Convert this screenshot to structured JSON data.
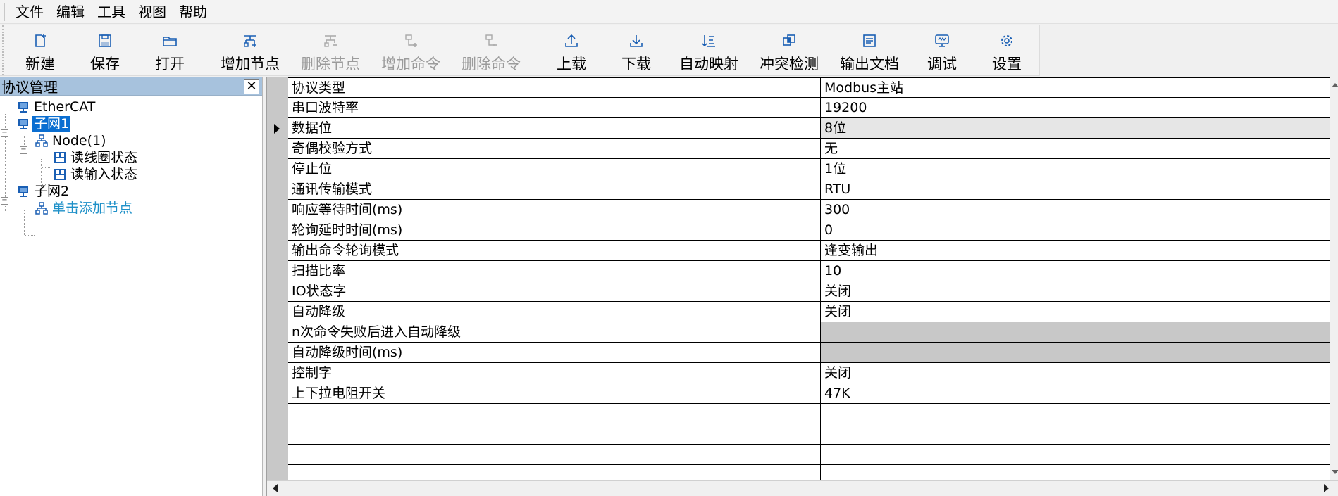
{
  "menu": [
    "文件",
    "编辑",
    "工具",
    "视图",
    "帮助"
  ],
  "toolbar": {
    "group1": [
      {
        "label": "新建",
        "icon": "new-file-icon",
        "enabled": true
      },
      {
        "label": "保存",
        "icon": "save-icon",
        "enabled": true
      },
      {
        "label": "打开",
        "icon": "open-folder-icon",
        "enabled": true
      }
    ],
    "group2": [
      {
        "label": "增加节点",
        "icon": "add-node-icon",
        "enabled": true
      },
      {
        "label": "删除节点",
        "icon": "delete-node-icon",
        "enabled": false
      },
      {
        "label": "增加命令",
        "icon": "add-command-icon",
        "enabled": false
      },
      {
        "label": "删除命令",
        "icon": "delete-command-icon",
        "enabled": false
      }
    ],
    "group3": [
      {
        "label": "上载",
        "icon": "upload-icon",
        "enabled": true
      },
      {
        "label": "下载",
        "icon": "download-icon",
        "enabled": true
      },
      {
        "label": "自动映射",
        "icon": "auto-map-icon",
        "enabled": true
      },
      {
        "label": "冲突检测",
        "icon": "conflict-detect-icon",
        "enabled": true
      },
      {
        "label": "输出文档",
        "icon": "export-doc-icon",
        "enabled": true
      },
      {
        "label": "调试",
        "icon": "debug-monitor-icon",
        "enabled": true
      },
      {
        "label": "设置",
        "icon": "settings-gear-icon",
        "enabled": true
      }
    ]
  },
  "panel": {
    "title": "协议管理",
    "close": "✕",
    "tree": [
      {
        "label": "EtherCAT",
        "icon": "network-icon"
      },
      {
        "label": "子网1",
        "icon": "network-icon",
        "selected": true
      },
      {
        "label": "Node(1)",
        "icon": "node-icon"
      },
      {
        "label": "读线圈状态",
        "icon": "command-icon"
      },
      {
        "label": "读输入状态",
        "icon": "command-icon"
      },
      {
        "label": "子网2",
        "icon": "network-icon"
      },
      {
        "label": "单击添加节点",
        "icon": "node-icon",
        "link": true
      }
    ]
  },
  "grid": {
    "rows": [
      {
        "name": "协议类型",
        "value": "Modbus主站"
      },
      {
        "name": "串口波特率",
        "value": "19200"
      },
      {
        "name": "数据位",
        "value": "8位",
        "current": true
      },
      {
        "name": "奇偶校验方式",
        "value": "无"
      },
      {
        "name": "停止位",
        "value": "1位"
      },
      {
        "name": "通讯传输模式",
        "value": "RTU"
      },
      {
        "name": "响应等待时间(ms)",
        "value": "300"
      },
      {
        "name": "轮询延时时间(ms)",
        "value": "0"
      },
      {
        "name": "输出命令轮询模式",
        "value": "逢变输出"
      },
      {
        "name": "扫描比率",
        "value": "10"
      },
      {
        "name": "IO状态字",
        "value": "关闭"
      },
      {
        "name": "自动降级",
        "value": "关闭"
      },
      {
        "name": "n次命令失败后进入自动降级",
        "value": "",
        "disabled": true
      },
      {
        "name": "自动降级时间(ms)",
        "value": "",
        "disabled": true
      },
      {
        "name": "控制字",
        "value": "关闭"
      },
      {
        "name": "上下拉电阻开关",
        "value": "47K"
      },
      {
        "name": "",
        "value": ""
      },
      {
        "name": "",
        "value": ""
      },
      {
        "name": "",
        "value": ""
      },
      {
        "name": "",
        "value": ""
      }
    ]
  },
  "colors": {
    "accent": "#1a5fb4",
    "selection": "#0a6ed1",
    "panel_header": "#a7c2dd",
    "link": "#1e90c8"
  }
}
